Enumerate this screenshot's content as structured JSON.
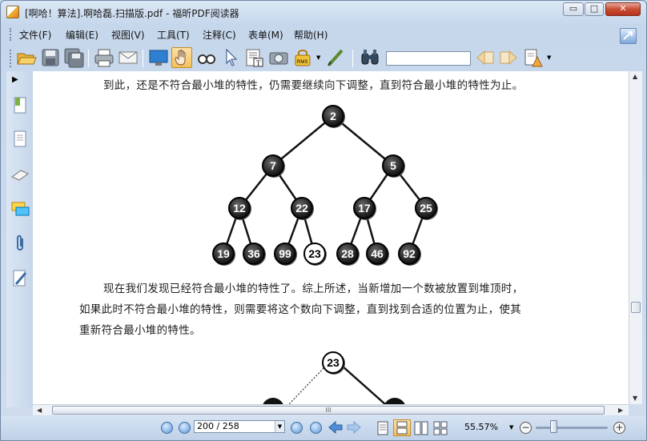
{
  "window": {
    "title": "[啊哈！算法].啊哈磊.扫描版.pdf - 福昕PDF阅读器",
    "minimize": "▭",
    "maximize": "□",
    "close": "✕"
  },
  "menu": [
    {
      "label": "文件(F)"
    },
    {
      "label": "编辑(E)"
    },
    {
      "label": "视图(V)"
    },
    {
      "label": "工具(T)"
    },
    {
      "label": "注释(C)"
    },
    {
      "label": "表单(M)"
    },
    {
      "label": "帮助(H)"
    }
  ],
  "toolbar": {
    "search_value": ""
  },
  "document": {
    "line1": "到此，还是不符合最小堆的特性，仍需要继续向下调整，直到符合最小堆的特性为止。",
    "para1": "现在我们发现已经符合最小堆的特性了。综上所述，当新增加一个数被放置到堆顶时，",
    "para2": "如果此时不符合最小堆的特性，则需要将这个数向下调整，直到找到合适的位置为止，使其",
    "para3": "重新符合最小堆的特性。",
    "tree1": [
      "2",
      "7",
      "5",
      "12",
      "22",
      "17",
      "25",
      "19",
      "36",
      "99",
      "23",
      "28",
      "46",
      "92"
    ],
    "tree2_root": "23"
  },
  "status": {
    "page_value": "200 / 258",
    "zoom": "55.57%",
    "hscroll_grip": "III"
  }
}
